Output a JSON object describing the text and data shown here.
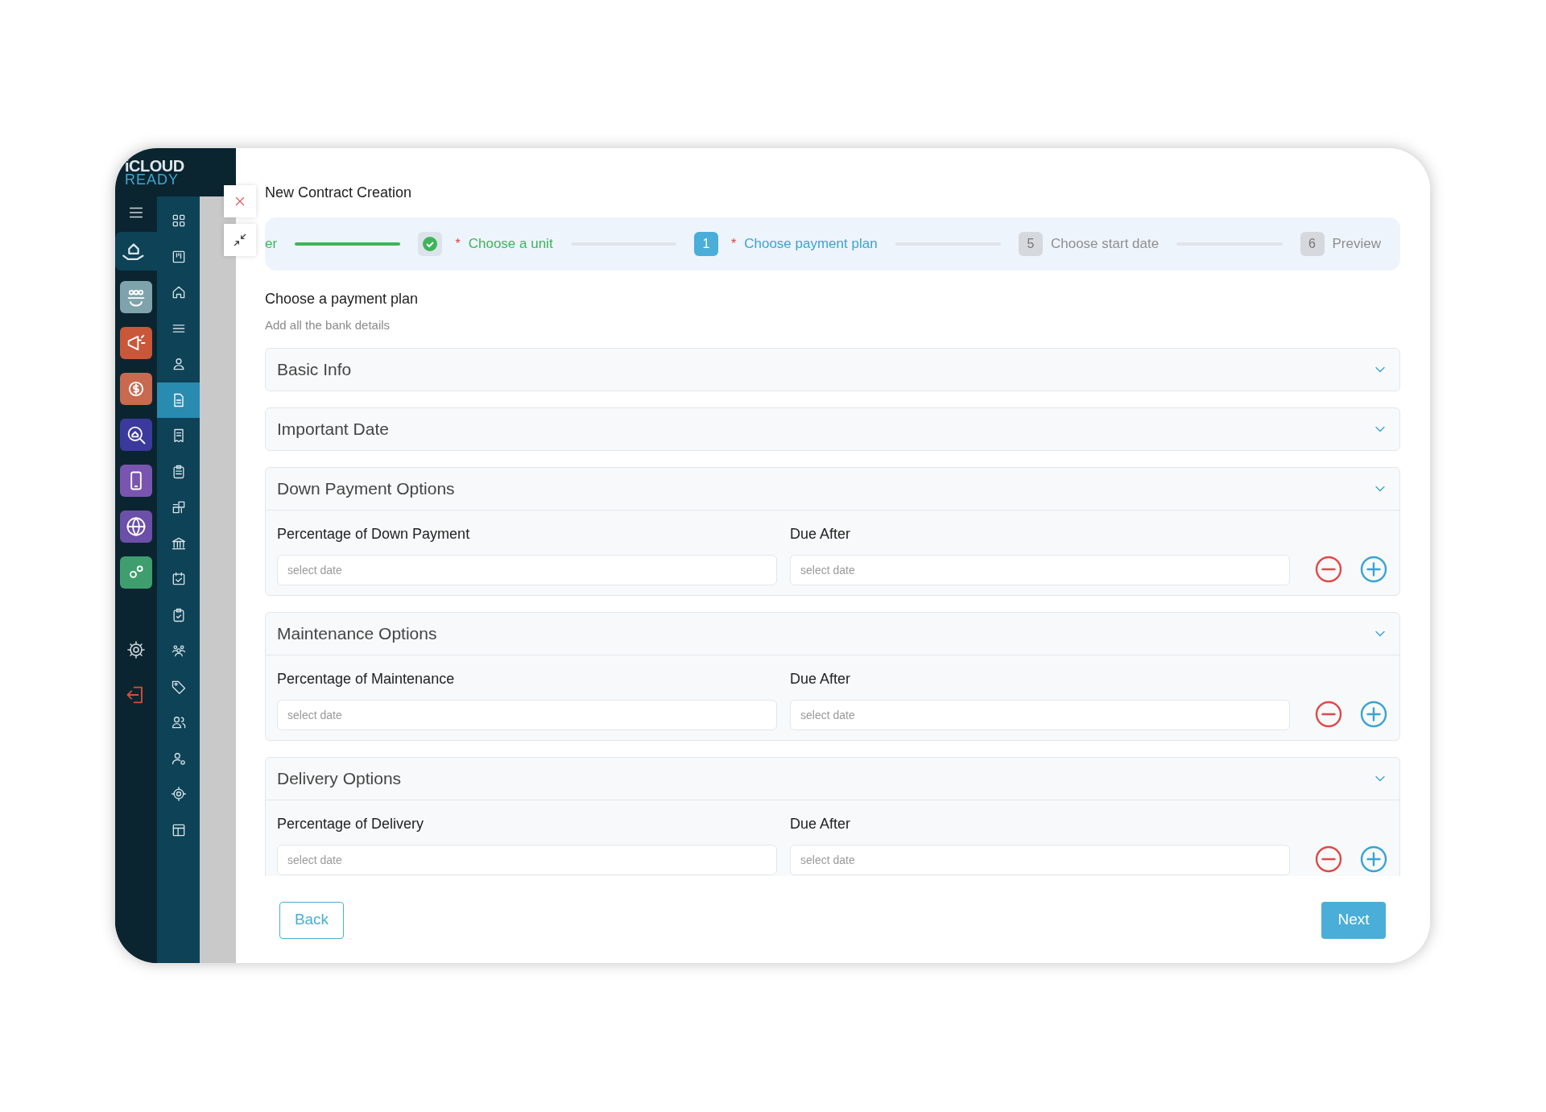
{
  "logo": {
    "line1": "iCLOUD",
    "line2": "READY"
  },
  "app_rail": {
    "items": [
      {
        "selected": true,
        "color": "#0e4256"
      },
      {
        "selected": false,
        "color": "#7fa3ab"
      },
      {
        "selected": false,
        "color": "#c9573a"
      },
      {
        "selected": false,
        "color": "#c76a50"
      },
      {
        "selected": false,
        "color": "#3b3a9c"
      },
      {
        "selected": false,
        "color": "#7a55b0"
      },
      {
        "selected": false,
        "color": "#6c4fa8"
      },
      {
        "selected": false,
        "color": "#3f9e6e"
      }
    ]
  },
  "nav_rail": {
    "items": [
      {
        "selected": false
      },
      {
        "selected": false
      },
      {
        "selected": false
      },
      {
        "selected": false
      },
      {
        "selected": false
      },
      {
        "selected": true
      },
      {
        "selected": false
      },
      {
        "selected": false
      },
      {
        "selected": false
      },
      {
        "selected": false
      },
      {
        "selected": false
      },
      {
        "selected": false
      },
      {
        "selected": false
      },
      {
        "selected": false
      },
      {
        "selected": false
      },
      {
        "selected": false
      },
      {
        "selected": false
      },
      {
        "selected": false
      }
    ]
  },
  "modal": {
    "title": "New Contract Creation",
    "stepper": {
      "steps": [
        {
          "label": "er",
          "completed": true,
          "selected": false
        },
        {
          "marker": "*",
          "label": "Choose a unit",
          "completed": true,
          "selected": false
        },
        {
          "number": "1",
          "marker": "*",
          "label": "Choose payment plan",
          "completed": false,
          "selected": true
        },
        {
          "number": "5",
          "label": "Choose start date",
          "completed": false,
          "selected": false
        },
        {
          "number": "6",
          "label": "Preview",
          "completed": false,
          "selected": false
        }
      ],
      "connectors": [
        {
          "level": 1
        },
        {
          "level": 0
        },
        {
          "level": 0
        },
        {
          "level": 0
        }
      ]
    },
    "heading": "Choose a payment plan",
    "subheading": "Add all the bank details",
    "sections": [
      {
        "title": "Basic Info",
        "expanded": false
      },
      {
        "title": "Important Date",
        "expanded": false
      },
      {
        "title": "Down Payment Options",
        "expanded": true,
        "fields": [
          {
            "label": "Percentage of Down Payment",
            "placeholder": "select date"
          },
          {
            "label": "Due After",
            "placeholder": "select date"
          }
        ]
      },
      {
        "title": "Maintenance Options",
        "expanded": true,
        "fields": [
          {
            "label": "Percentage of Maintenance",
            "placeholder": "select date"
          },
          {
            "label": "Due After",
            "placeholder": "select date"
          }
        ]
      },
      {
        "title": "Delivery Options",
        "expanded": true,
        "fields": [
          {
            "label": "Percentage of Delivery",
            "placeholder": "select date"
          },
          {
            "label": "Due After",
            "placeholder": "select date"
          }
        ]
      }
    ],
    "buttons": {
      "back": "Back",
      "next": "Next"
    }
  }
}
